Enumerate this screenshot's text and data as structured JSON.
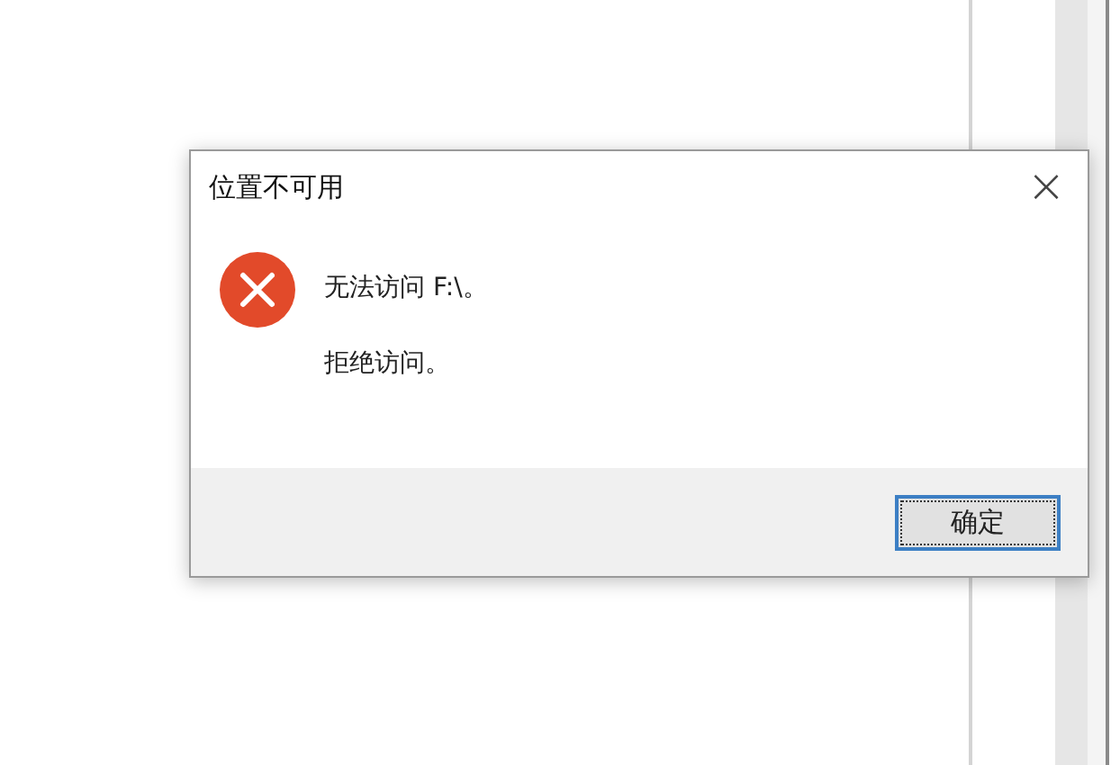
{
  "dialog": {
    "title": "位置不可用",
    "close": "×",
    "messages": [
      "无法访问 F:\\。",
      "拒绝访问。"
    ],
    "buttons": [
      {
        "label": "确定",
        "focused": true
      }
    ]
  }
}
